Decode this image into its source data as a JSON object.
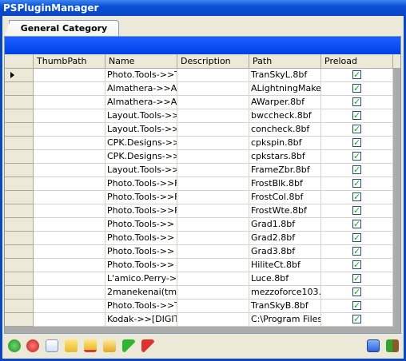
{
  "window": {
    "title": "PSPluginManager"
  },
  "tabs": [
    {
      "label": "General Category"
    }
  ],
  "grid": {
    "columns": [
      "ThumbPath",
      "Name",
      "Description",
      "Path",
      "Preload"
    ],
    "rows": [
      {
        "thumb": "",
        "name": "Photo.Tools->>T",
        "description": "",
        "path": "TranSkyL.8bf",
        "preload": true
      },
      {
        "thumb": "",
        "name": "Almathera->>A.",
        "description": "",
        "path": "ALightningMaker",
        "preload": true
      },
      {
        "thumb": "",
        "name": "Almathera->>A.",
        "description": "",
        "path": "AWarper.8bf",
        "preload": true
      },
      {
        "thumb": "",
        "name": "Layout.Tools->>",
        "description": "",
        "path": "bwccheck.8bf",
        "preload": true
      },
      {
        "thumb": "",
        "name": "Layout.Tools->>",
        "description": "",
        "path": "concheck.8bf",
        "preload": true
      },
      {
        "thumb": "",
        "name": "CPK.Designs->>",
        "description": "",
        "path": "cpkspin.8bf",
        "preload": true
      },
      {
        "thumb": "",
        "name": "CPK.Designs->>",
        "description": "",
        "path": "cpkstars.8bf",
        "preload": true
      },
      {
        "thumb": "",
        "name": "Layout.Tools->>",
        "description": "",
        "path": "FrameZbr.8bf",
        "preload": true
      },
      {
        "thumb": "",
        "name": "Photo.Tools->>F",
        "description": "",
        "path": "FrostBlk.8bf",
        "preload": true
      },
      {
        "thumb": "",
        "name": "Photo.Tools->>F",
        "description": "",
        "path": "FrostCol.8bf",
        "preload": true
      },
      {
        "thumb": "",
        "name": "Photo.Tools->>F",
        "description": "",
        "path": "FrostWte.8bf",
        "preload": true
      },
      {
        "thumb": "",
        "name": "Photo.Tools->>",
        "description": "",
        "path": "Grad1.8bf",
        "preload": true
      },
      {
        "thumb": "",
        "name": "Photo.Tools->>",
        "description": "",
        "path": "Grad2.8bf",
        "preload": true
      },
      {
        "thumb": "",
        "name": "Photo.Tools->>",
        "description": "",
        "path": "Grad3.8bf",
        "preload": true
      },
      {
        "thumb": "",
        "name": "Photo.Tools->>",
        "description": "",
        "path": "HiliteCt.8bf",
        "preload": true
      },
      {
        "thumb": "",
        "name": "L'amico.Perry->",
        "description": "",
        "path": "Luce.8bf",
        "preload": true
      },
      {
        "thumb": "",
        "name": "2manekenai(tm)",
        "description": "",
        "path": "mezzoforce103.",
        "preload": true
      },
      {
        "thumb": "",
        "name": "Photo.Tools->>T",
        "description": "",
        "path": "TranSkyB.8bf",
        "preload": true
      },
      {
        "thumb": "",
        "name": "Kodak->>[DIGIT",
        "description": "",
        "path": "C:\\Program Files",
        "preload": true
      }
    ]
  },
  "toolbar": {
    "left_icons": [
      "add-icon",
      "remove-icon",
      "new-document-icon",
      "folder-add-icon",
      "folder-remove-icon",
      "open-folder-icon",
      "flag-green-icon",
      "flag-red-icon"
    ],
    "right_icons": [
      "save-icon",
      "exit-icon"
    ]
  }
}
